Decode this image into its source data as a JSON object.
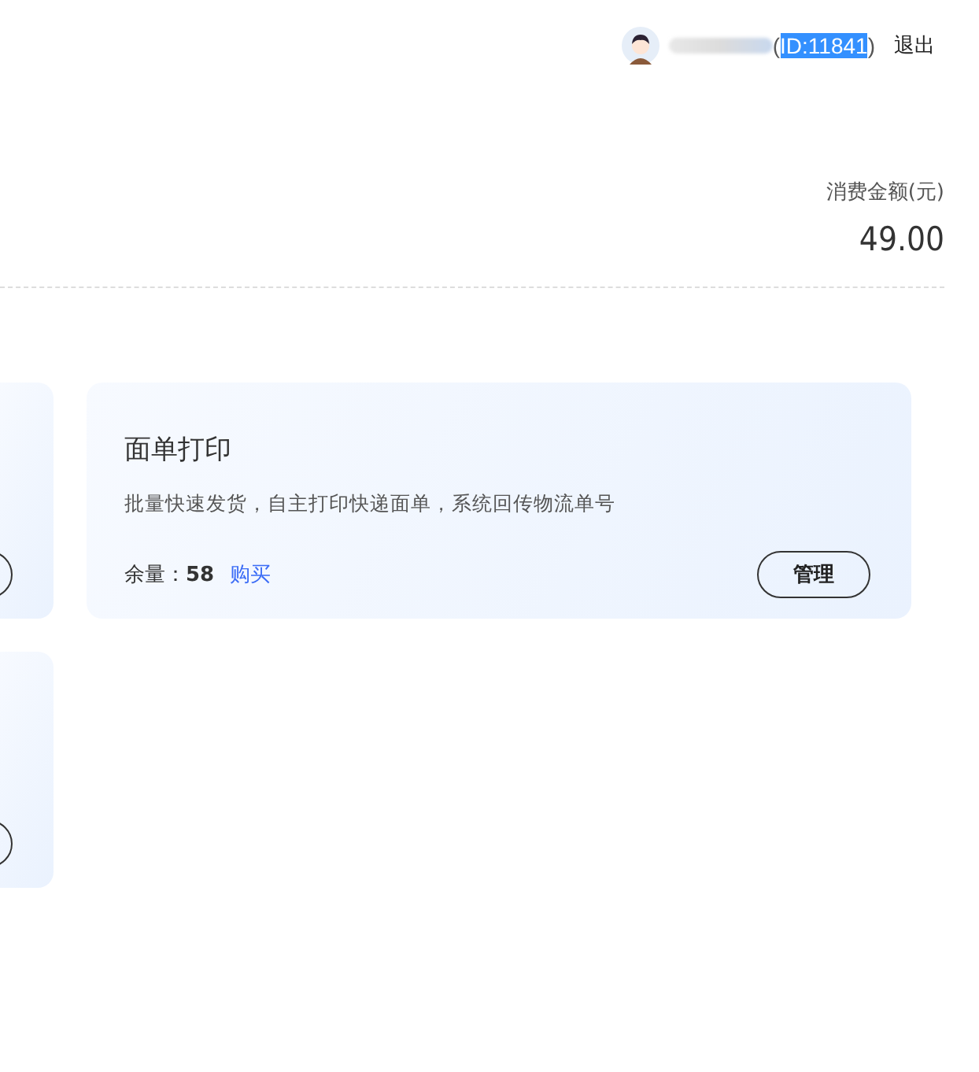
{
  "user": {
    "id_prefix": "(",
    "id": "ID:11841",
    "id_suffix": ")",
    "logout": "退出"
  },
  "summary": {
    "label": "消费金额(元)",
    "value": "49.00"
  },
  "card": {
    "title": "面单打印",
    "description": "批量快速发货，自主打印快递面单，系统回传物流单号",
    "remaining_label": "余量：",
    "remaining": "58",
    "buy": "购买",
    "manage": "管理"
  }
}
